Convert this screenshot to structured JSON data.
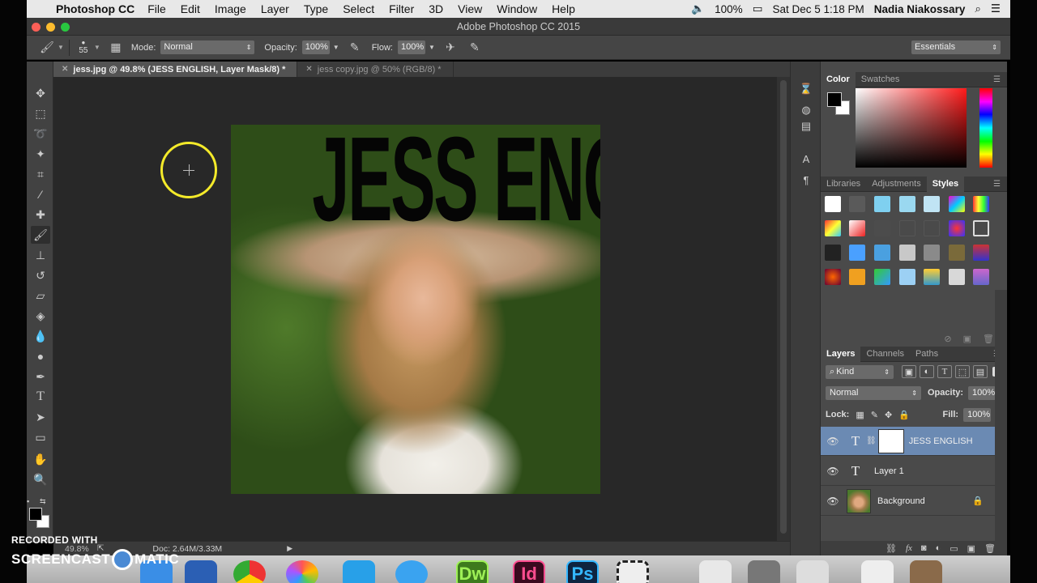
{
  "menubar": {
    "app_name": "Photoshop CC",
    "menus": [
      "File",
      "Edit",
      "Image",
      "Layer",
      "Type",
      "Select",
      "Filter",
      "3D",
      "View",
      "Window",
      "Help"
    ],
    "battery": "100%",
    "datetime": "Sat Dec 5  1:18 PM",
    "user": "Nadia Niakossary"
  },
  "window": {
    "title": "Adobe Photoshop CC 2015"
  },
  "options": {
    "brush_size": "55",
    "mode_label": "Mode:",
    "mode_value": "Normal",
    "opacity_label": "Opacity:",
    "opacity_value": "100%",
    "flow_label": "Flow:",
    "flow_value": "100%",
    "workspace": "Essentials"
  },
  "doc_tabs": [
    {
      "label": "jess.jpg @ 49.8% (JESS ENGLISH, Layer Mask/8) *",
      "active": true
    },
    {
      "label": "jess copy.jpg @ 50% (RGB/8) *",
      "active": false
    }
  ],
  "canvas": {
    "text_layer": "JESS ENGLISH"
  },
  "status": {
    "zoom": "49.8%",
    "doc_info": "Doc: 2.64M/3.33M"
  },
  "color_panel": {
    "tabs": [
      "Color",
      "Swatches"
    ]
  },
  "styles_panel": {
    "tabs": [
      "Libraries",
      "Adjustments",
      "Styles"
    ]
  },
  "layers_panel": {
    "tabs": [
      "Layers",
      "Channels",
      "Paths"
    ],
    "filter": "Kind",
    "blend_mode": "Normal",
    "opacity_label": "Opacity:",
    "opacity_value": "100%",
    "lock_label": "Lock:",
    "fill_label": "Fill:",
    "fill_value": "100%",
    "layers": [
      {
        "name": "JESS ENGLISH",
        "kind": "text",
        "selected": true
      },
      {
        "name": "Layer 1",
        "kind": "text",
        "selected": false
      },
      {
        "name": "Background",
        "kind": "image",
        "selected": false
      }
    ]
  },
  "dock": {
    "apps": [
      {
        "label": "Dw",
        "color": "#3d7a1d",
        "fg": "#9ef056"
      },
      {
        "label": "Id",
        "color": "#3a0a1e",
        "fg": "#ff4d8f"
      },
      {
        "label": "Ps",
        "color": "#0e2440",
        "fg": "#34b7ff"
      }
    ]
  },
  "watermark": {
    "line1": "RECORDED WITH",
    "line2a": "SCREENCAST",
    "line2b": "MATIC"
  }
}
